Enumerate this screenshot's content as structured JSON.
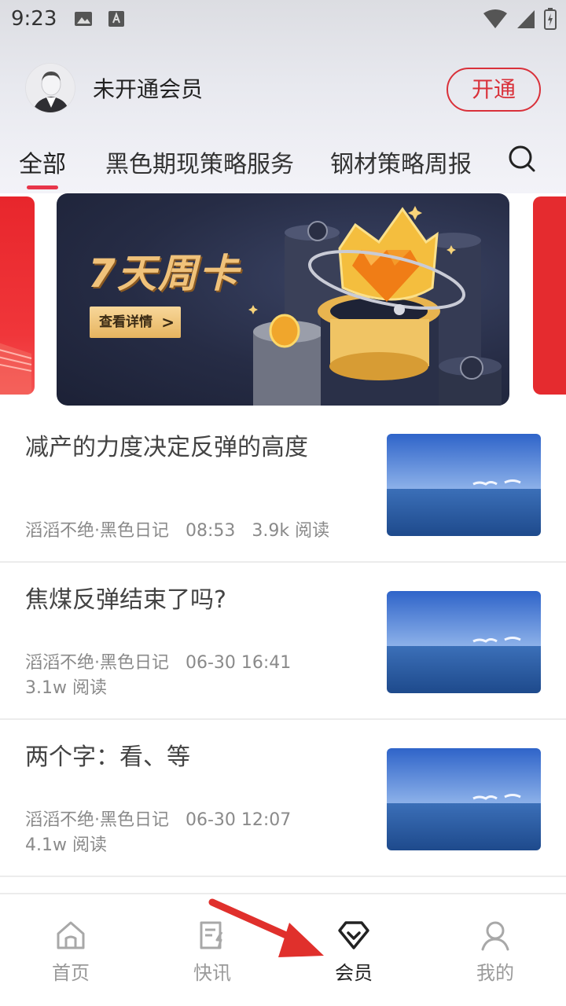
{
  "status_bar": {
    "time": "9:23"
  },
  "member": {
    "label": "未开通会员",
    "open_button": "开通"
  },
  "tabs": [
    {
      "label": "全部",
      "active": true
    },
    {
      "label": "黑色期现策略服务",
      "active": false
    },
    {
      "label": "钢材策略周报",
      "active": false
    }
  ],
  "banner": {
    "title": "7天周卡",
    "button_label": "查看详情",
    "button_arrow": ">"
  },
  "articles": [
    {
      "title": "减产的力度决定反弹的高度",
      "author": "滔滔不绝·黑色日记",
      "time": "08:53",
      "reads": "3.9k 阅读"
    },
    {
      "title": "焦煤反弹结束了吗?",
      "author": "滔滔不绝·黑色日记",
      "time": "06-30 16:41",
      "reads": "3.1w 阅读"
    },
    {
      "title": "两个字：看、等",
      "author": "滔滔不绝·黑色日记",
      "time": "06-30 12:07",
      "reads": "4.1w 阅读"
    }
  ],
  "bottom_nav": [
    {
      "label": "首页",
      "icon": "home-icon",
      "active": false
    },
    {
      "label": "快讯",
      "icon": "news-icon",
      "active": false
    },
    {
      "label": "会员",
      "icon": "vip-diamond-icon",
      "active": true
    },
    {
      "label": "我的",
      "icon": "profile-icon",
      "active": false
    }
  ],
  "colors": {
    "accent_red": "#d9313a",
    "tab_underline": "#e8364a",
    "annotation_arrow": "#e0302c"
  }
}
